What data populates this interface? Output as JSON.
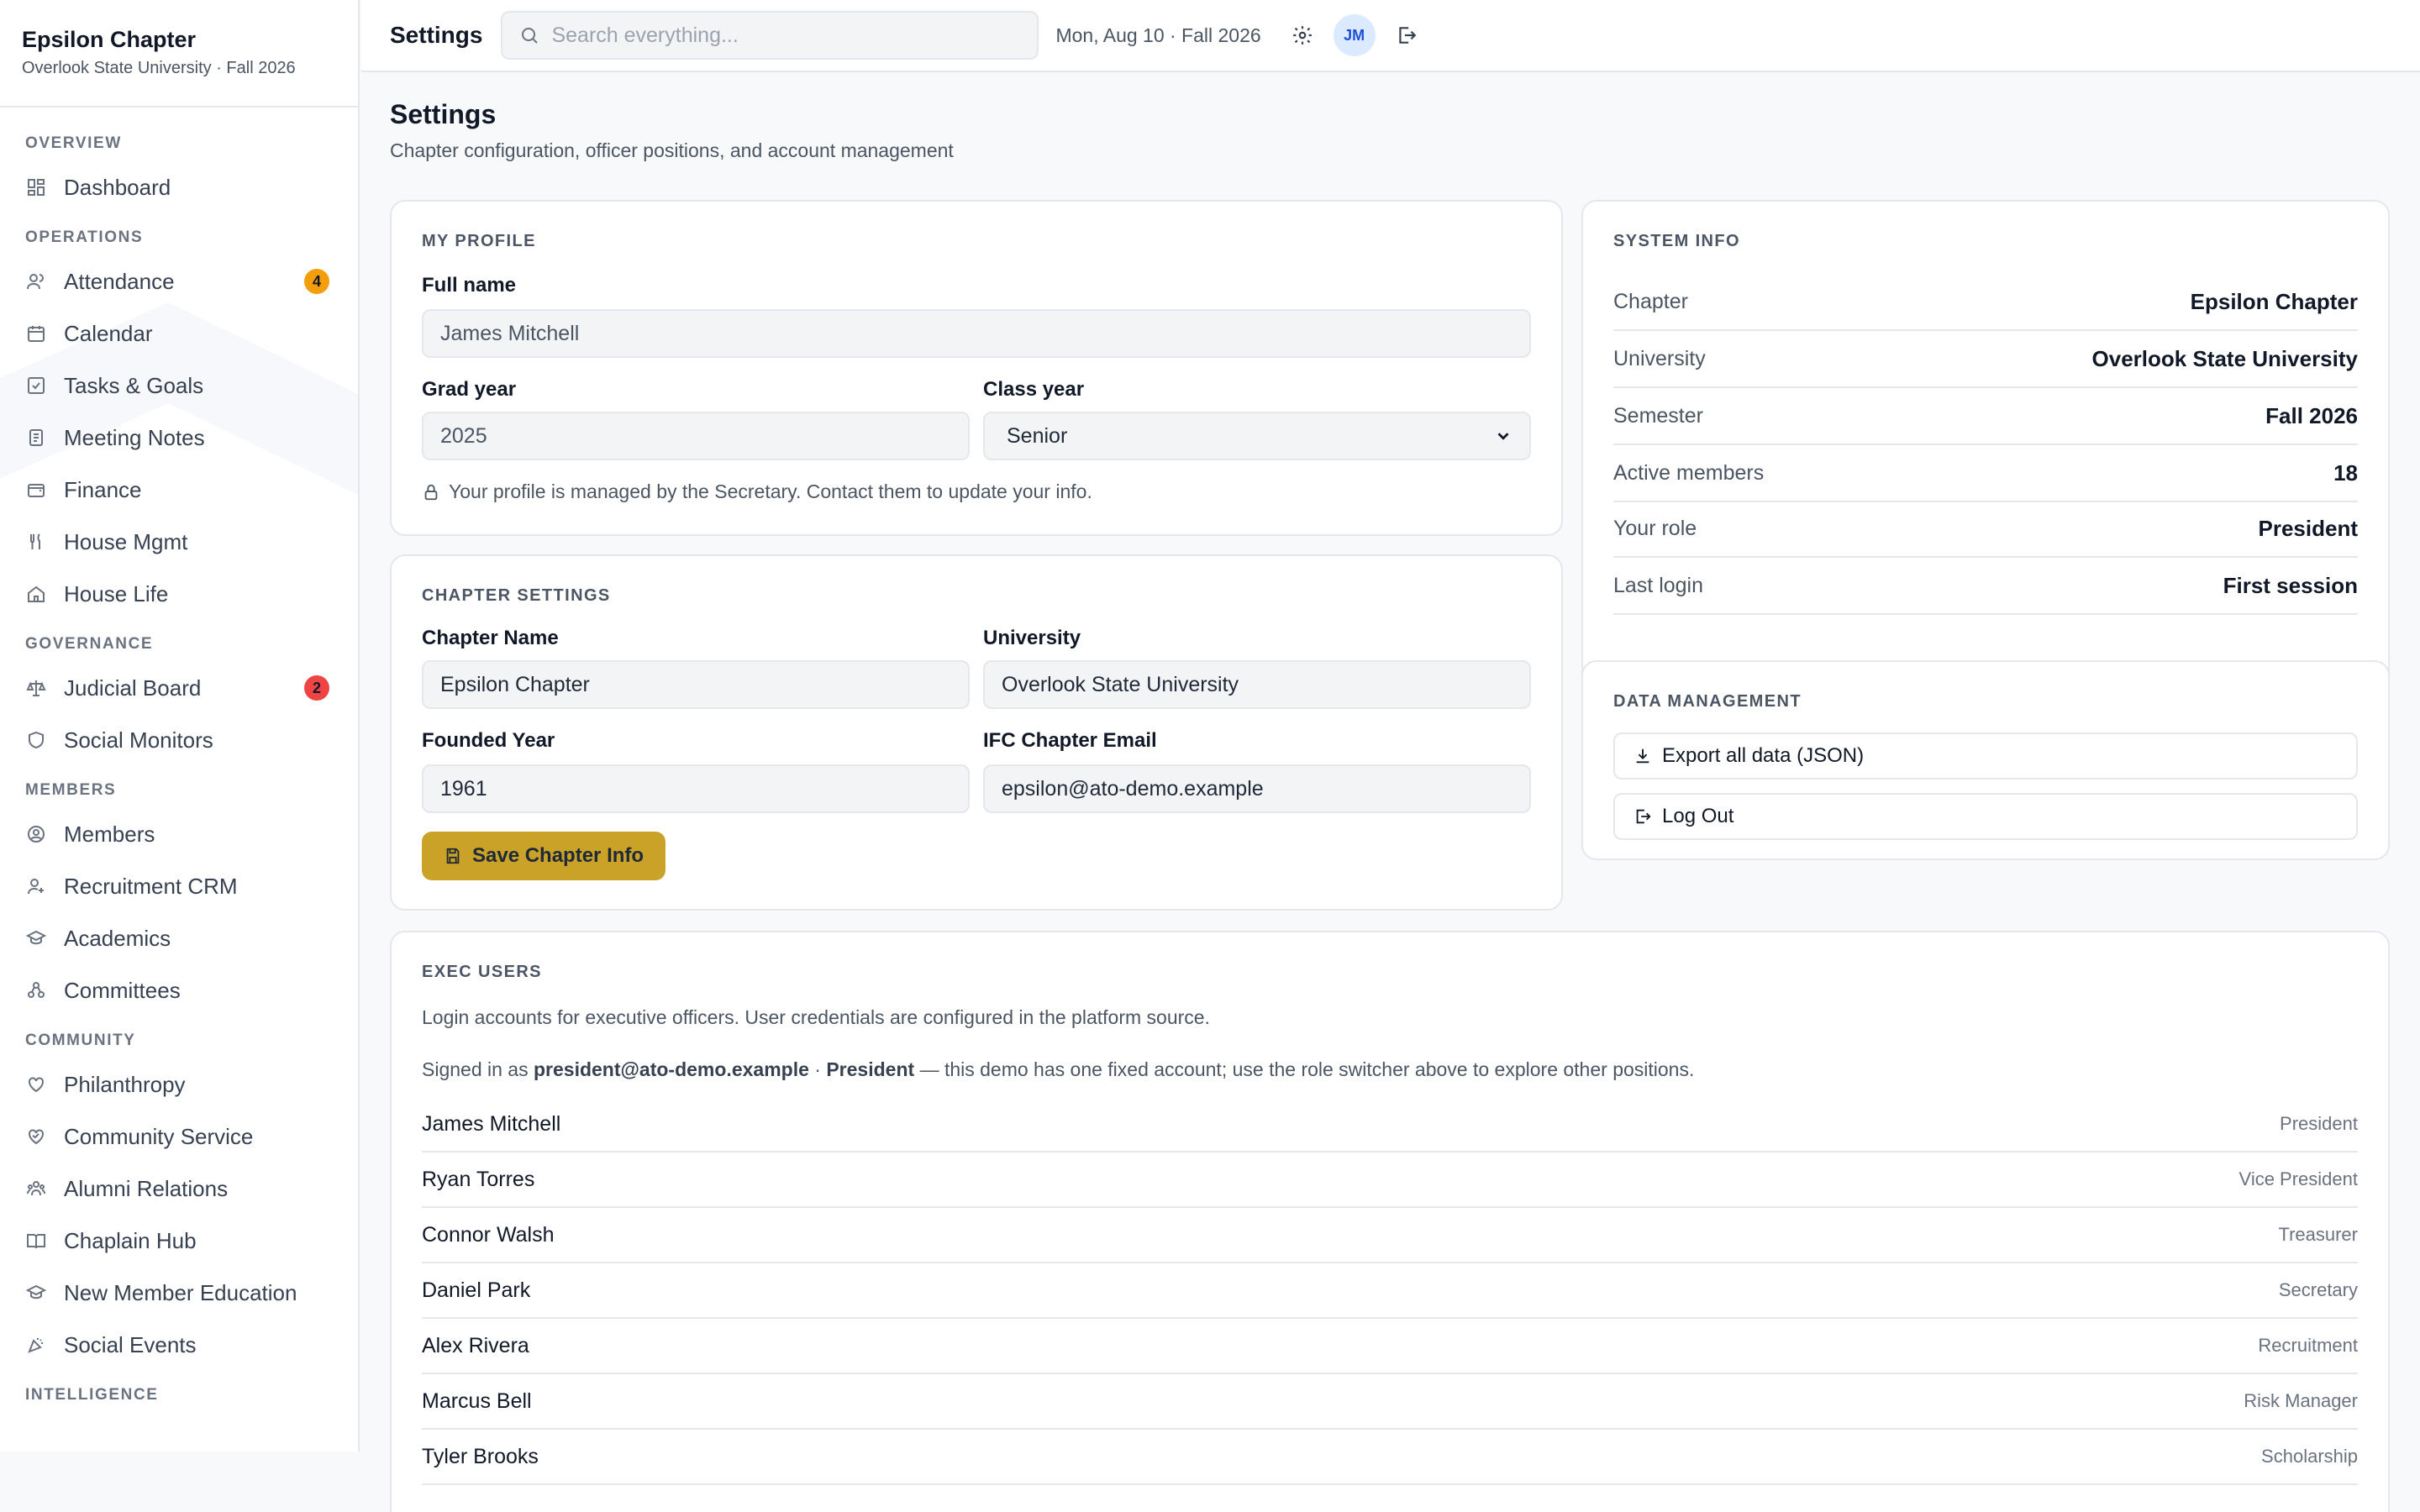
{
  "sidebar": {
    "chapter_name": "Epsilon Chapter",
    "chapter_sub": "Overlook State University · Fall 2026",
    "sections": {
      "overview": "OVERVIEW",
      "operations": "OPERATIONS",
      "governance": "GOVERNANCE",
      "members": "MEMBERS",
      "community": "COMMUNITY",
      "intelligence": "INTELLIGENCE"
    },
    "items": {
      "dashboard": "Dashboard",
      "attendance": "Attendance",
      "attendance_badge": "4",
      "calendar": "Calendar",
      "tasks": "Tasks & Goals",
      "meeting_notes": "Meeting Notes",
      "finance": "Finance",
      "house_mgmt": "House Mgmt",
      "house_life": "House Life",
      "judicial": "Judicial Board",
      "judicial_badge": "2",
      "social_monitors": "Social Monitors",
      "members": "Members",
      "recruitment": "Recruitment CRM",
      "academics": "Academics",
      "committees": "Committees",
      "philanthropy": "Philanthropy",
      "community_service": "Community Service",
      "alumni": "Alumni Relations",
      "chaplain": "Chaplain Hub",
      "nme": "New Member Education",
      "social_events": "Social Events"
    },
    "badge_colors": {
      "attendance": "#f59e0b",
      "judicial": "#ef4444"
    }
  },
  "topbar": {
    "title": "Settings",
    "search_placeholder": "Search everything...",
    "date": "Mon, Aug 10 · Fall 2026",
    "avatar_initials": "JM"
  },
  "page": {
    "title": "Settings",
    "subtitle": "Chapter configuration, officer positions, and account management"
  },
  "profile": {
    "heading": "MY PROFILE",
    "full_name_label": "Full name",
    "full_name": "James Mitchell",
    "grad_year_label": "Grad year",
    "grad_year": "2025",
    "class_year_label": "Class year",
    "class_year": "Senior",
    "note": "Your profile is managed by the Secretary. Contact them to update your info."
  },
  "chapter": {
    "heading": "CHAPTER SETTINGS",
    "name_label": "Chapter Name",
    "name": "Epsilon Chapter",
    "university_label": "University",
    "university": "Overlook State University",
    "founded_label": "Founded Year",
    "founded": "1961",
    "email_label": "IFC Chapter Email",
    "email": "epsilon@ato-demo.example",
    "save_label": "Save Chapter Info",
    "accent": "#c9a227"
  },
  "system": {
    "heading": "SYSTEM INFO",
    "rows": [
      {
        "k": "Chapter",
        "v": "Epsilon Chapter"
      },
      {
        "k": "University",
        "v": "Overlook State University"
      },
      {
        "k": "Semester",
        "v": "Fall 2026"
      },
      {
        "k": "Active members",
        "v": "18"
      },
      {
        "k": "Your role",
        "v": "President"
      },
      {
        "k": "Last login",
        "v": "First session"
      }
    ]
  },
  "data_mgmt": {
    "heading": "DATA MANAGEMENT",
    "export_label": "Export all data (JSON)",
    "logout_label": "Log Out"
  },
  "exec": {
    "heading": "EXEC USERS",
    "desc": "Login accounts for executive officers. User credentials are configured in the platform source.",
    "signed_in_prefix": "Signed in as",
    "signed_in_email": "president@ato-demo.example",
    "signed_in_sep": "·",
    "signed_in_role": "President",
    "signed_in_suffix": "— this demo has one fixed account; use the role switcher above to explore other positions.",
    "users": [
      {
        "name": "James Mitchell",
        "role": "President"
      },
      {
        "name": "Ryan Torres",
        "role": "Vice President"
      },
      {
        "name": "Connor Walsh",
        "role": "Treasurer"
      },
      {
        "name": "Daniel Park",
        "role": "Secretary"
      },
      {
        "name": "Alex Rivera",
        "role": "Recruitment"
      },
      {
        "name": "Marcus Bell",
        "role": "Risk Manager"
      },
      {
        "name": "Tyler Brooks",
        "role": "Scholarship"
      }
    ]
  }
}
